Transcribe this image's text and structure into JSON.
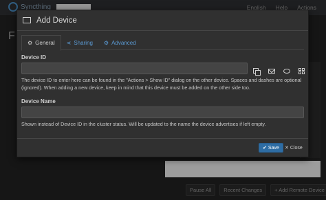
{
  "app": {
    "brand": "Syncthing",
    "nav": [
      "English",
      "Help",
      "Actions"
    ],
    "bg_title": "F",
    "bg_buttons": [
      "Pause All",
      "Recent Changes",
      "+ Add Remote Device"
    ]
  },
  "modal": {
    "title": "Add Device",
    "tabs": [
      {
        "label": "General",
        "icon": "gear-icon",
        "active": true
      },
      {
        "label": "Sharing",
        "icon": "share-icon",
        "active": false
      },
      {
        "label": "Advanced",
        "icon": "cogs-icon",
        "active": false
      }
    ],
    "device_id": {
      "label": "Device ID",
      "value": "",
      "help": "The device ID to enter here can be found in the \"Actions > Show ID\" dialog on the other device. Spaces and dashes are optional (ignored). When adding a new device, keep in mind that this device must be added on the other side too.",
      "icons": [
        "copy-icon",
        "mail-icon",
        "chat-icon",
        "qr-code-icon"
      ]
    },
    "device_name": {
      "label": "Device Name",
      "value": "",
      "help": "Shown instead of Device ID in the cluster status. Will be updated to the name the device advertises if left empty."
    },
    "footer": {
      "save_label": "Save",
      "close_label": "Close"
    }
  },
  "colors": {
    "accent": "#2e6da4",
    "link": "#5b9bd5",
    "modal_bg": "#303030",
    "input_bg": "#444444"
  }
}
